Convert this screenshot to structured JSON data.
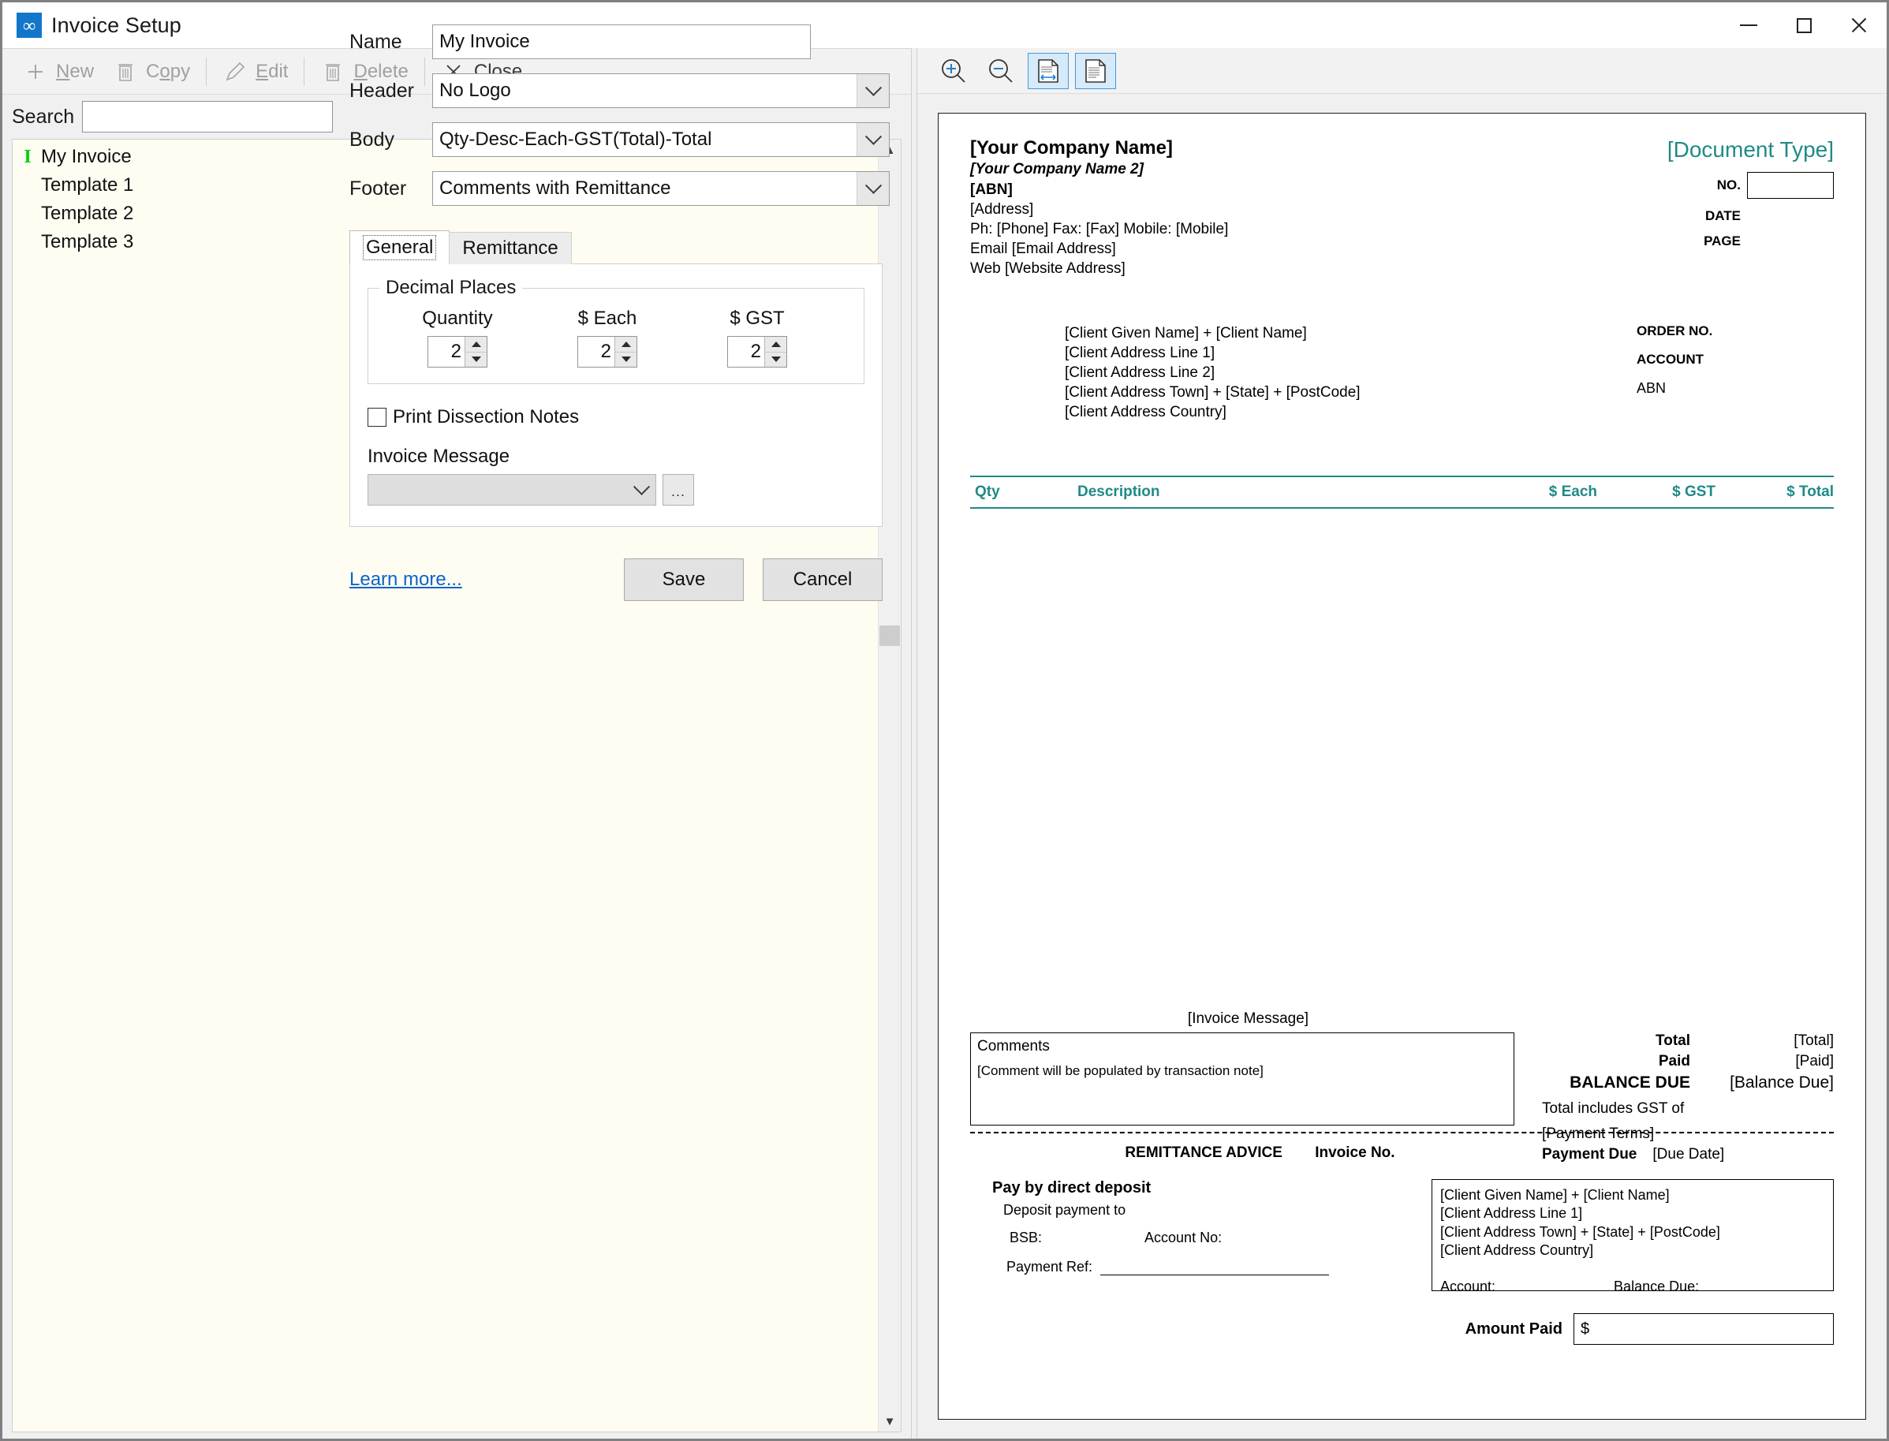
{
  "window": {
    "title": "Invoice Setup",
    "app_icon": "invoice-app-icon",
    "minimize": "minimize-icon",
    "maximize": "maximize-icon",
    "close": "close-icon"
  },
  "toolbar": {
    "items": [
      {
        "label": "New",
        "underline": "N",
        "icon": "plus-icon",
        "disabled": true
      },
      {
        "label": "Copy",
        "underline": "o",
        "icon": "copy-icon",
        "disabled": true
      },
      {
        "label": "Edit",
        "underline": "E",
        "icon": "pencil-icon",
        "disabled": true
      },
      {
        "label": "Delete",
        "underline": "D",
        "icon": "trash-icon",
        "disabled": true
      },
      {
        "label": "Close",
        "underline": "C",
        "icon": "x-icon",
        "disabled": false
      }
    ]
  },
  "search": {
    "label": "Search",
    "value": "",
    "placeholder": ""
  },
  "template_list": {
    "items": [
      {
        "label": "My Invoice",
        "marker": "I",
        "selected": true
      },
      {
        "label": "Template 1",
        "marker": "",
        "selected": false
      },
      {
        "label": "Template 2",
        "marker": "",
        "selected": false
      },
      {
        "label": "Template 3",
        "marker": "",
        "selected": false
      }
    ],
    "scroll_up": "chevron-up-icon",
    "scroll_down": "chevron-down-icon"
  },
  "form": {
    "name_label": "Name",
    "name_value": "My Invoice",
    "header_label": "Header",
    "header_value": "No Logo",
    "body_label": "Body",
    "body_value": "Qty-Desc-Each-GST(Total)-Total",
    "footer_label": "Footer",
    "footer_value": "Comments with Remittance",
    "tabs": [
      {
        "label": "General",
        "active": true
      },
      {
        "label": "Remittance",
        "active": false
      }
    ],
    "decimal_places": {
      "legend": "Decimal Places",
      "fields": [
        {
          "label": "Quantity",
          "value": "2"
        },
        {
          "label": "$ Each",
          "value": "2"
        },
        {
          "label": "$ GST",
          "value": "2"
        }
      ]
    },
    "print_dissection_notes": {
      "label": "Print Dissection Notes",
      "checked": false
    },
    "invoice_message": {
      "label": "Invoice Message",
      "value": "",
      "ellipsis_label": "...",
      "disabled": true
    },
    "learn_more": "Learn more...",
    "save_label": "Save",
    "cancel_label": "Cancel"
  },
  "preview_toolbar": {
    "zoom_in": "zoom-in-icon",
    "zoom_out": "zoom-out-icon",
    "fit_width": "fit-width-icon",
    "fit_page": "fit-page-icon"
  },
  "preview": {
    "company": {
      "name": "[Your Company Name]",
      "name2": "[Your Company Name 2]",
      "abn": "[ABN]",
      "address": "[Address]",
      "phone_line": "Ph: [Phone]    Fax: [Fax]    Mobile: [Mobile]",
      "email_line": "Email [Email Address]",
      "web_line": "Web [Website Address]"
    },
    "doc": {
      "type": "[Document Type]",
      "no_label": "NO.",
      "no_value": "",
      "date_label": "DATE",
      "page_label": "PAGE"
    },
    "client": [
      "[Client Given Name] + [Client Name]",
      "[Client Address Line 1]",
      "[Client Address Line 2]",
      "[Client Address Town] + [State] + [PostCode]",
      "[Client Address Country]"
    ],
    "order": {
      "order_no": "ORDER NO.",
      "account": "ACCOUNT",
      "abn": "ABN"
    },
    "table_headers": {
      "qty": "Qty",
      "description": "Description",
      "each": "$ Each",
      "gst": "$ GST",
      "total": "$ Total"
    },
    "invoice_message_placeholder": "[Invoice Message]",
    "comments": {
      "title": "Comments",
      "note": "[Comment will be populated by transaction note]"
    },
    "totals": {
      "total_label": "Total",
      "total_value": "[Total]",
      "paid_label": "Paid",
      "paid_value": "[Paid]",
      "balance_label": "BALANCE DUE",
      "balance_value": "[Balance Due]",
      "gst_note": "Total includes GST of",
      "payment_terms": "[Payment Terms]",
      "payment_due_label": "Payment Due",
      "payment_due_value": "[Due Date]"
    },
    "remittance": {
      "title": "REMITTANCE ADVICE",
      "invoice_no_label": "Invoice No.",
      "pay_heading": "Pay by direct deposit",
      "deposit_to": "Deposit payment to",
      "bsb_label": "BSB:",
      "account_no_label": "Account No:",
      "payment_ref_label": "Payment Ref:",
      "client": [
        "[Client Given Name] + [Client Name]",
        "[Client Address Line 1]",
        "[Client Address Town] + [State] + [PostCode]",
        "[Client Address Country]"
      ],
      "account_label": "Account:",
      "balance_due_label": "Balance Due:",
      "amount_paid_label": "Amount Paid",
      "amount_paid_value": "$"
    }
  },
  "colors": {
    "accent_teal": "#1f8a87",
    "link_blue": "#0b63ce",
    "app_blue": "#1277c9",
    "marker_green": "#00d000",
    "list_bg": "#fffdf2"
  }
}
